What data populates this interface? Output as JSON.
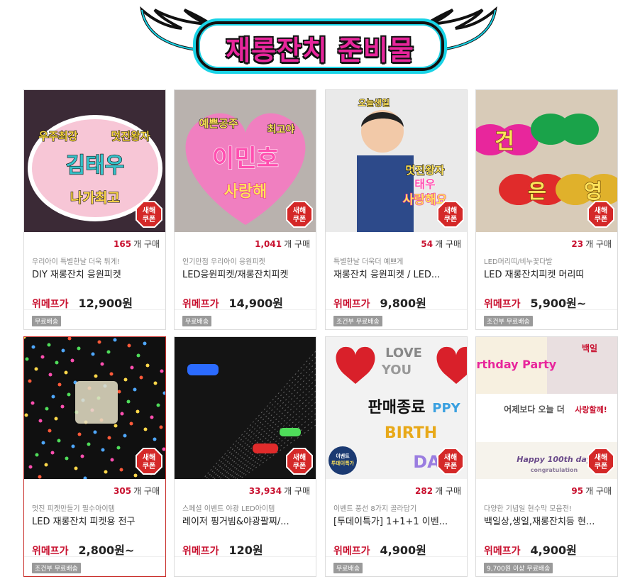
{
  "banner": {
    "title_part1": "재롱잔치",
    "title_part2": "준비물"
  },
  "coupon": {
    "line1": "새해",
    "line2": "쿠폰"
  },
  "price_label": "위메프가",
  "buy_suffix": "개 구매",
  "products": [
    {
      "buys": "165",
      "desc": "우리아이 특별한날 더욱 튀게!",
      "name": "DIY 재롱잔치 응원피켓",
      "price": "12,900원",
      "shipping": "무료배송",
      "image_text": [
        "우주최강",
        "멋진왕자",
        "김태우",
        "나가최고"
      ]
    },
    {
      "buys": "1,041",
      "desc": "인기만점 우리아이 응원피켓",
      "name": "LED응원피켓/재롱잔치피켓",
      "price": "14,900원",
      "shipping": "무료배송",
      "image_text": [
        "예쁜공주",
        "최고야",
        "이민호",
        "사랑해"
      ]
    },
    {
      "buys": "54",
      "desc": "특별한날 더욱더 예쁘게",
      "name": "재롱잔치 응원피켓 / LED...",
      "price": "9,800원",
      "shipping": "조건부 무료배송",
      "image_text": [
        "오늘생일",
        "멋진왕자",
        "태우",
        "사랑해요"
      ]
    },
    {
      "buys": "23",
      "desc": "LED머리띠/비누꽃다발",
      "name": "LED 재롱잔치피켓 머리띠",
      "price": "5,900원~",
      "shipping": "조건부 무료배송",
      "image_text": [
        "건",
        "은",
        "영"
      ]
    },
    {
      "buys": "305",
      "desc": "멋진 피켓만들기 필수아이템",
      "name": "LED 재롱잔치 피켓용 전구",
      "price": "2,800원~",
      "shipping": "조건부 무료배송",
      "image_text": []
    },
    {
      "buys": "33,934",
      "desc": "스페셜 이벤트 야광 LED아이템",
      "name": "레이저 핑거빔&야광팔찌/...",
      "price": "120원",
      "shipping": "",
      "image_text": []
    },
    {
      "buys": "282",
      "desc": "이벤트 풍선 8가지 골라담기",
      "name": "[투데이특가] 1+1+1 이벤...",
      "price": "4,900원",
      "shipping": "무료배송",
      "image_text": [
        "LOVE",
        "YOU",
        "판매종료",
        "PPY",
        "BIRTH",
        "DAY",
        "이벤트",
        "투데이특가"
      ]
    },
    {
      "buys": "95",
      "desc": "다양한 기념일 현수막 모음전!",
      "name": "백일상,생일,재롱잔치등 현...",
      "price": "4,900원",
      "shipping": "9,700원 이상 무료배송",
      "image_text": [
        "Birthday Party",
        "백일",
        "어제보다 오늘 더",
        "사랑할께!",
        "Happy 100th day",
        "congratulation"
      ]
    }
  ],
  "colors": {
    "accent_red": "#c8102e",
    "title_pink": "#e8269c",
    "title_cyan": "#19d3e6"
  }
}
